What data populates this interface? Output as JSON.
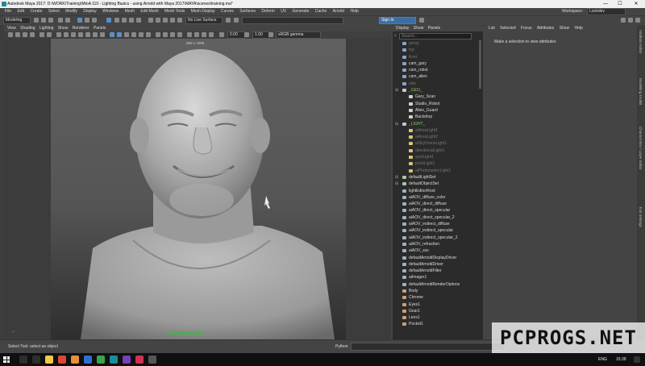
{
  "window": {
    "title": "Autodesk Maya 2017: D:\\WORK\\Training\\MtoA 110 - Lighting Basics - using Arnold with Maya 2017\\MAYA\\scenes\\training.ma*",
    "controls": [
      "—",
      "☐",
      "✕"
    ]
  },
  "menubar": {
    "items": [
      "File",
      "Edit",
      "Create",
      "Select",
      "Modify",
      "Display",
      "Windows",
      "Mesh",
      "Edit Mesh",
      "Mesh Tools",
      "Mesh Display",
      "Curves",
      "Surfaces",
      "Deform",
      "UV",
      "Generate",
      "Cache",
      "Arnold",
      "Help"
    ],
    "workspace_label": "Workspace :",
    "workspace_value": "Lookdev"
  },
  "statusline": {
    "mode": "Modeling",
    "live_surface": "No Live Surface",
    "sign_in": "Sign In"
  },
  "viewport": {
    "menu": [
      "View",
      "Shading",
      "Lighting",
      "Show",
      "Renderer",
      "Panels"
    ],
    "field_a": "0.00",
    "field_b": "1.00",
    "color_space": "sRGB gamma",
    "resolution_label": "960 x 1080"
  },
  "outliner": {
    "menu": [
      "Display",
      "Show",
      "Panels"
    ],
    "search_placeholder": "Search...",
    "rows": [
      {
        "label": "persp",
        "style": "dim",
        "indent": 0,
        "icon": "camera-icon"
      },
      {
        "label": "top",
        "style": "dim",
        "indent": 0,
        "icon": "camera-icon"
      },
      {
        "label": "front",
        "style": "dim",
        "indent": 0,
        "icon": "camera-icon"
      },
      {
        "label": "cam_gary",
        "style": "normal",
        "indent": 0,
        "icon": "camera-icon"
      },
      {
        "label": "cam_robot",
        "style": "normal",
        "indent": 0,
        "icon": "camera-icon"
      },
      {
        "label": "cam_alien",
        "style": "normal",
        "indent": 0,
        "icon": "camera-icon"
      },
      {
        "label": "side",
        "style": "dim",
        "indent": 0,
        "icon": "camera-icon"
      },
      {
        "label": "_GEO_",
        "style": "group",
        "indent": 0,
        "icon": "group-icon"
      },
      {
        "label": "Gary_Scan",
        "style": "normal",
        "indent": 1,
        "icon": "mesh-icon"
      },
      {
        "label": "Studio_Robot",
        "style": "normal",
        "indent": 1,
        "icon": "mesh-icon"
      },
      {
        "label": "Alien_Guard",
        "style": "normal",
        "indent": 1,
        "icon": "mesh-icon"
      },
      {
        "label": "Backdrop",
        "style": "normal",
        "indent": 1,
        "icon": "mesh-icon"
      },
      {
        "label": "_LIGHT_",
        "style": "group",
        "indent": 0,
        "icon": "group-icon"
      },
      {
        "label": "aiAreaLight1",
        "style": "dim",
        "indent": 1,
        "icon": "light-icon"
      },
      {
        "label": "aiAreaLight2",
        "style": "dim",
        "indent": 1,
        "icon": "light-icon"
      },
      {
        "label": "aiSkyDomeLight1",
        "style": "dim",
        "indent": 1,
        "icon": "light-icon"
      },
      {
        "label": "directionalLight1",
        "style": "dim",
        "indent": 1,
        "icon": "light-icon"
      },
      {
        "label": "spotLight1",
        "style": "dim",
        "indent": 1,
        "icon": "light-icon"
      },
      {
        "label": "pointLight1",
        "style": "dim",
        "indent": 1,
        "icon": "light-icon"
      },
      {
        "label": "aiPhotometricLight1",
        "style": "dim",
        "indent": 1,
        "icon": "light-icon"
      },
      {
        "label": "defaultLightSet",
        "style": "normal",
        "indent": 0,
        "icon": "set-icon"
      },
      {
        "label": "defaultObjectSet",
        "style": "normal",
        "indent": 0,
        "icon": "set-icon"
      },
      {
        "label": "lightEditorRoot",
        "style": "normal",
        "indent": 0,
        "icon": "node-icon"
      },
      {
        "label": "aiAOV_diffuse_color",
        "style": "normal",
        "indent": 0,
        "icon": "node-icon"
      },
      {
        "label": "aiAOV_direct_diffuse",
        "style": "normal",
        "indent": 0,
        "icon": "node-icon"
      },
      {
        "label": "aiAOV_direct_specular",
        "style": "normal",
        "indent": 0,
        "icon": "node-icon"
      },
      {
        "label": "aiAOV_direct_specular_2",
        "style": "normal",
        "indent": 0,
        "icon": "node-icon"
      },
      {
        "label": "aiAOV_indirect_diffuse",
        "style": "normal",
        "indent": 0,
        "icon": "node-icon"
      },
      {
        "label": "aiAOV_indirect_specular",
        "style": "normal",
        "indent": 0,
        "icon": "node-icon"
      },
      {
        "label": "aiAOV_indirect_specular_2",
        "style": "normal",
        "indent": 0,
        "icon": "node-icon"
      },
      {
        "label": "aiAOV_refraction",
        "style": "normal",
        "indent": 0,
        "icon": "node-icon"
      },
      {
        "label": "aiAOV_sss",
        "style": "normal",
        "indent": 0,
        "icon": "node-icon"
      },
      {
        "label": "defaultArnoldDisplayDriver",
        "style": "normal",
        "indent": 0,
        "icon": "node-icon"
      },
      {
        "label": "defaultArnoldDriver",
        "style": "normal",
        "indent": 0,
        "icon": "node-icon"
      },
      {
        "label": "defaultArnoldFilter",
        "style": "normal",
        "indent": 0,
        "icon": "node-icon"
      },
      {
        "label": "aiImager1",
        "style": "normal",
        "indent": 0,
        "icon": "node-icon"
      },
      {
        "label": "defaultArnoldRenderOptions",
        "style": "normal",
        "indent": 0,
        "icon": "node-icon"
      },
      {
        "label": "Body",
        "style": "normal",
        "indent": 0,
        "icon": "shader-icon"
      },
      {
        "label": "Chrome",
        "style": "normal",
        "indent": 0,
        "icon": "shader-icon"
      },
      {
        "label": "Eyes1",
        "style": "normal",
        "indent": 0,
        "icon": "shader-icon"
      },
      {
        "label": "Gear1",
        "style": "normal",
        "indent": 0,
        "icon": "shader-icon"
      },
      {
        "label": "Lens1",
        "style": "normal",
        "indent": 0,
        "icon": "shader-icon"
      },
      {
        "label": "Pocket1",
        "style": "normal",
        "indent": 0,
        "icon": "shader-icon"
      }
    ]
  },
  "attribute_editor": {
    "menu": [
      "List",
      "Selected",
      "Focus",
      "Attributes",
      "Show",
      "Help"
    ],
    "message": "Make a selection to view attributes"
  },
  "side_tabs": [
    "Attribute Editor",
    "Modelling Toolkit",
    "Channel Box / Layer Editor",
    "Tool Settings"
  ],
  "bottom": {
    "help": "Select Tool: select an object",
    "python_label": "Python"
  },
  "taskbar": {
    "language": "ENG",
    "time": "15:39"
  },
  "watermark": "PCPROGS.NET",
  "colors": {
    "maya_bg": "#444444",
    "outliner_bg": "#2b2b2b",
    "group_green": "#7fcf63",
    "sign_in_blue": "#3a6ea5"
  }
}
